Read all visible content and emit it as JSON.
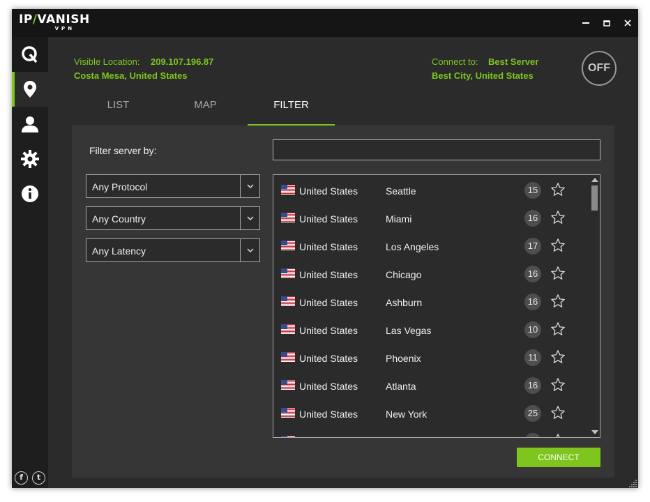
{
  "app": {
    "logo_ip": "IP",
    "logo_vanish": "VANISH",
    "logo_sub": "VPN"
  },
  "window_controls": {
    "minimize": "▬",
    "maximize": "❐",
    "close": "✕"
  },
  "sidebar": {
    "items": [
      {
        "name": "quick-connect",
        "icon": "q-logo-icon"
      },
      {
        "name": "server-locations",
        "icon": "location-pin-icon"
      },
      {
        "name": "account",
        "icon": "user-icon"
      },
      {
        "name": "settings",
        "icon": "gear-icon"
      },
      {
        "name": "info",
        "icon": "info-icon"
      }
    ],
    "social": {
      "facebook": "f",
      "twitter": "t"
    }
  },
  "status": {
    "visible_location_label": "Visible Location:",
    "ip": "209.107.196.87",
    "location": "Costa Mesa, United States",
    "connect_to_label": "Connect to:",
    "server": "Best Server",
    "server_location": "Best City, United States",
    "toggle": "OFF"
  },
  "tabs": [
    {
      "label": "LIST",
      "active": false
    },
    {
      "label": "MAP",
      "active": false
    },
    {
      "label": "FILTER",
      "active": true
    }
  ],
  "filter": {
    "label": "Filter server by:",
    "search_value": "",
    "protocol": "Any Protocol",
    "country": "Any Country",
    "latency": "Any Latency"
  },
  "servers": [
    {
      "country": "United States",
      "city": "Seattle",
      "ping": "15"
    },
    {
      "country": "United States",
      "city": "Miami",
      "ping": "16"
    },
    {
      "country": "United States",
      "city": "Los Angeles",
      "ping": "17"
    },
    {
      "country": "United States",
      "city": "Chicago",
      "ping": "16"
    },
    {
      "country": "United States",
      "city": "Ashburn",
      "ping": "16"
    },
    {
      "country": "United States",
      "city": "Las Vegas",
      "ping": "10"
    },
    {
      "country": "United States",
      "city": "Phoenix",
      "ping": "11"
    },
    {
      "country": "United States",
      "city": "Atlanta",
      "ping": "16"
    },
    {
      "country": "United States",
      "city": "New York",
      "ping": "25"
    },
    {
      "country": "United States",
      "city": "",
      "ping": ""
    }
  ],
  "actions": {
    "connect": "CONNECT"
  },
  "colors": {
    "accent": "#7ec61e",
    "background": "#2b2b2b",
    "panel": "#363636",
    "titlebar": "#151515"
  }
}
